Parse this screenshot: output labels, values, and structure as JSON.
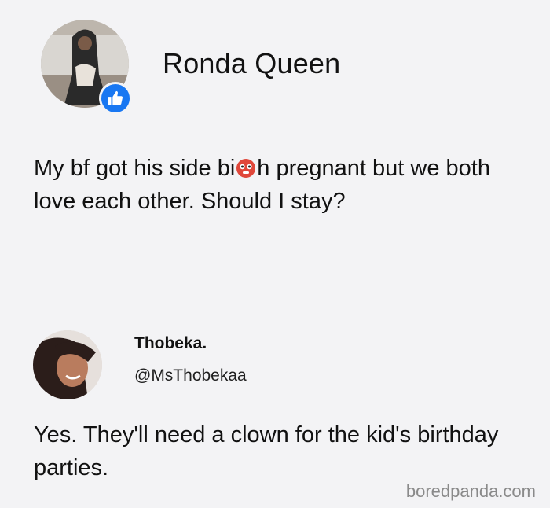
{
  "post": {
    "author_name": "Ronda Queen",
    "badge_icon": "thumbs-up-icon",
    "text_before": "My bf got his side bi",
    "text_emoji": "flushed-face-emoji",
    "text_after": "h pregnant but we both love each other. Should I stay?"
  },
  "reply": {
    "author_name": "Thobeka.",
    "handle": "@MsThobekaa",
    "text": "Yes. They'll need a clown for the kid's birthday parties."
  },
  "watermark": "boredpanda.com",
  "colors": {
    "background": "#f3f3f5",
    "badge": "#1877f2",
    "text": "#111111",
    "watermark": "#8a8a8a"
  }
}
